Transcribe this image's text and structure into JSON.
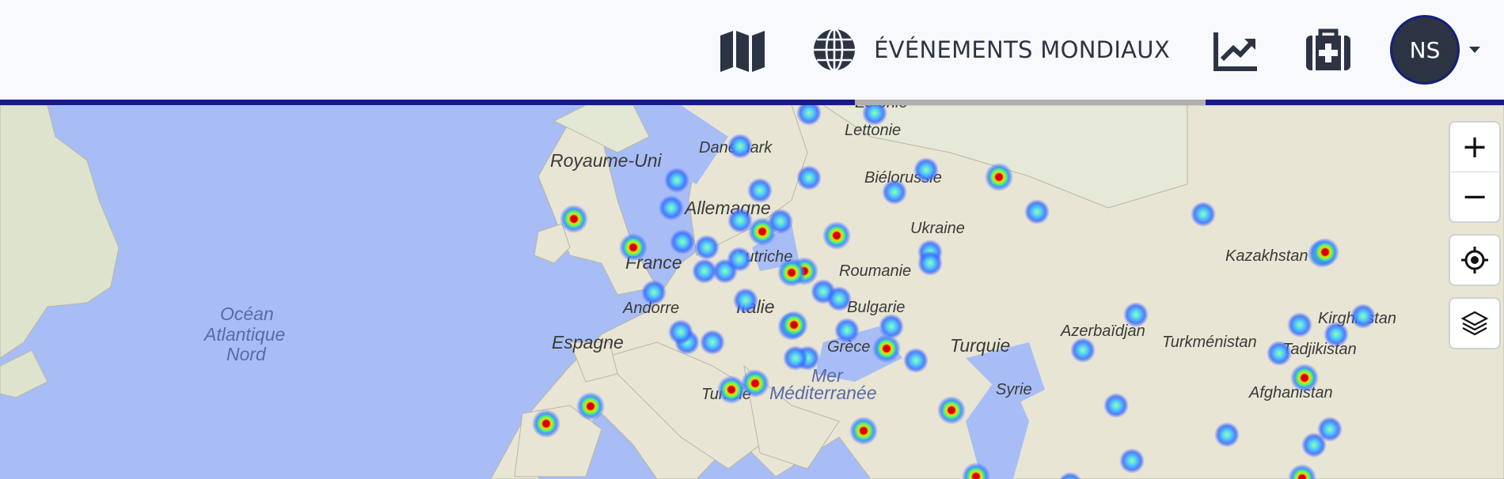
{
  "header": {
    "nav": [
      {
        "icon": "map-icon",
        "label": ""
      },
      {
        "icon": "globe-icon",
        "label": "ÉVÉNEMENTS MONDIAUX"
      },
      {
        "icon": "chart-line-icon",
        "label": ""
      },
      {
        "icon": "medical-kit-icon",
        "label": ""
      }
    ],
    "user_initials": "NS",
    "active_tab": "ÉVÉNEMENTS MONDIAUX",
    "colors": {
      "accent": "#1a1a8c",
      "active_indicator": "#b0b0b0",
      "text": "#2c3444",
      "bar_bg": "#f7f9fd"
    }
  },
  "map": {
    "labels": {
      "royaume_uni": "Royaume-Uni",
      "danemark": "Danemark",
      "estonie": "Estonie",
      "lettonie": "Lettonie",
      "bielorussie": "Biélorussie",
      "allemagne": "Allemagne",
      "france": "France",
      "autriche": "Autriche",
      "roumanie": "Roumanie",
      "ukraine": "Ukraine",
      "kazakhstan": "Kazakhstan",
      "andorre": "Andorre",
      "italie": "Italie",
      "bulgarie": "Bulgarie",
      "espagne": "Espagne",
      "grece": "Grèce",
      "turquie": "Turquie",
      "azerbaidjan": "Azerbaïdjan",
      "turkmenistan": "Turkménistan",
      "kirghizstan": "Kirghizstan",
      "tadjikistan": "Tadjikistan",
      "syrie": "Syrie",
      "tunisie": "Tunisie",
      "afghanistan": "Afghanistan",
      "ocean_1": "Océan",
      "ocean_2": "Atlantique",
      "ocean_3": "Nord",
      "mer_1": "Mer",
      "mer_2": "Méditerranée"
    },
    "colors": {
      "water": "#a8bdf5",
      "land": "#e9e6d6",
      "heat_low": "#3b5bff",
      "heat_mid": "#4dff6a",
      "heat_high": "#d60000"
    }
  },
  "controls": {
    "zoom_in": "+",
    "zoom_out": "−",
    "locate_icon": "crosshair-icon",
    "layers_icon": "layers-icon"
  }
}
